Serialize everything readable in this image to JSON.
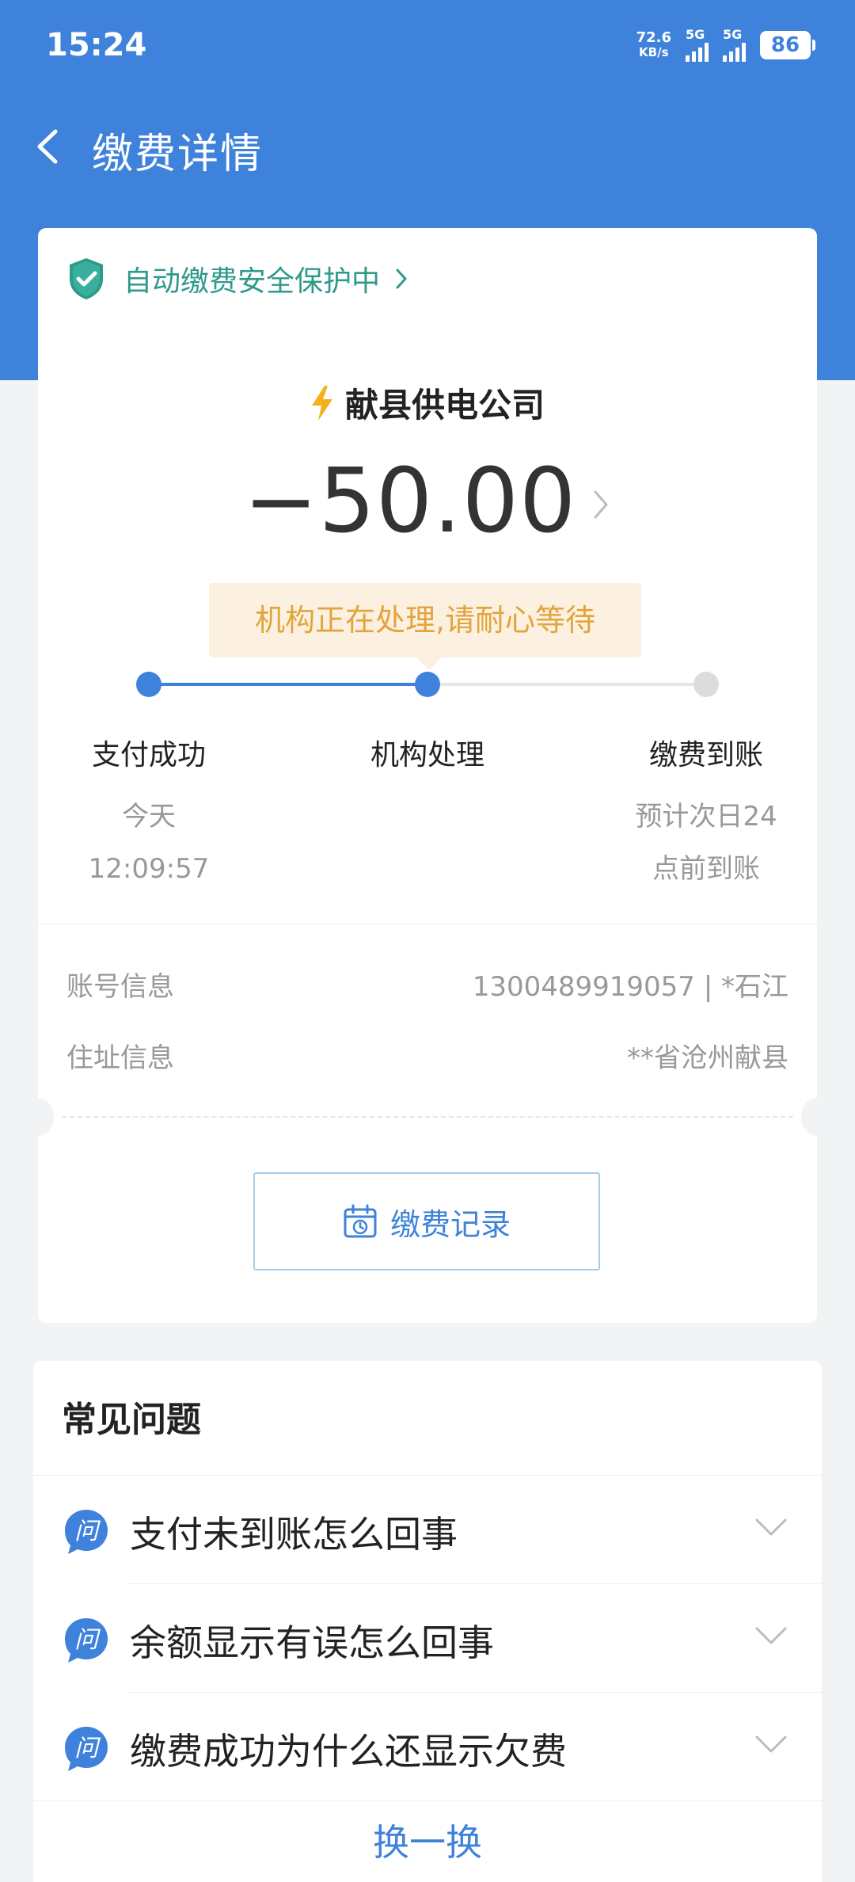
{
  "status_bar": {
    "time": "15:24",
    "net_speed_value": "72.6",
    "net_speed_unit": "KB/s",
    "sim1_label": "5G",
    "sim2_label": "5G",
    "battery": "86"
  },
  "nav": {
    "title": "缴费详情",
    "back_icon": "chevron-left-icon"
  },
  "card": {
    "security_text": "自动缴费安全保护中",
    "security_icon": "shield-check-icon",
    "company": "献县供电公司",
    "company_icon": "lightning-icon",
    "amount": "−50.00",
    "status_tip": "机构正在处理,请耐心等待",
    "progress": {
      "current_step": 2,
      "total_steps": 3,
      "steps": [
        {
          "title": "支付成功",
          "sub1": "今天",
          "sub2": "12:09:57"
        },
        {
          "title": "机构处理",
          "sub1": "",
          "sub2": ""
        },
        {
          "title": "缴费到账",
          "sub1": "预计次日24",
          "sub2": "点前到账"
        }
      ]
    },
    "info": [
      {
        "label": "账号信息",
        "value": "1300489919057 | *石江"
      },
      {
        "label": "住址信息",
        "value": "**省沧州献县"
      }
    ],
    "record_button": "缴费记录",
    "record_icon": "calendar-clock-icon"
  },
  "faq": {
    "title": "常见问题",
    "icon_text": "问",
    "items": [
      {
        "question": "支付未到账怎么回事"
      },
      {
        "question": "余额显示有误怎么回事"
      },
      {
        "question": "缴费成功为什么还显示欠费"
      }
    ],
    "more_button": "换一换"
  },
  "colors": {
    "primary": "#3f82db",
    "security_green": "#2e9a8a",
    "warning_orange": "#e3a43b",
    "lightning_yellow": "#f2b21a"
  }
}
